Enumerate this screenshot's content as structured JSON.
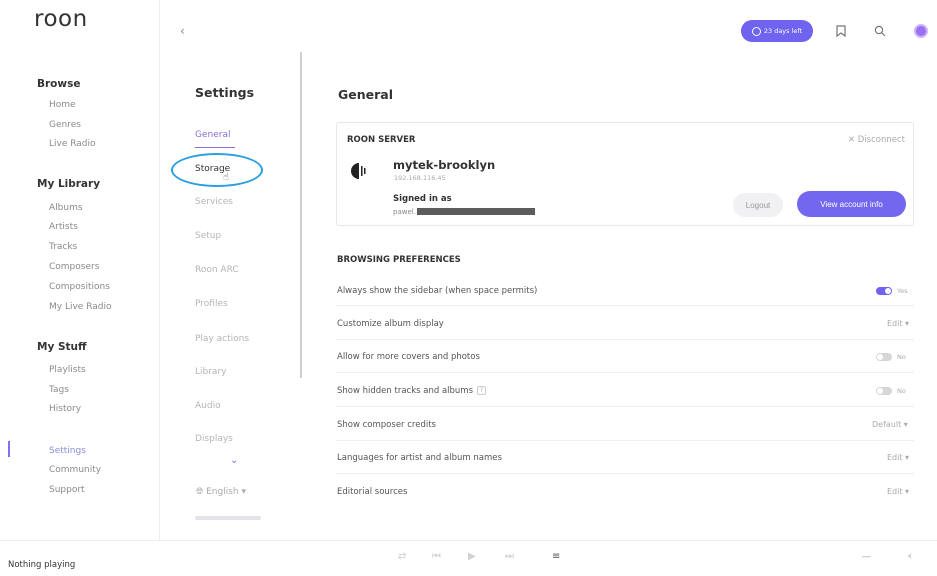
{
  "app": {
    "logo": "roon"
  },
  "sidebar": {
    "sections": [
      {
        "title": "Browse",
        "items": [
          "Home",
          "Genres",
          "Live Radio"
        ]
      },
      {
        "title": "My Library",
        "items": [
          "Albums",
          "Artists",
          "Tracks",
          "Composers",
          "Compositions",
          "My Live Radio"
        ]
      },
      {
        "title": "My Stuff",
        "items": [
          "Playlists",
          "Tags",
          "History"
        ]
      }
    ],
    "bottom_items": [
      "Settings",
      "Community",
      "Support"
    ]
  },
  "topbar": {
    "back_icon": "chevron-left-icon",
    "trial_label": "23 days left",
    "icons": [
      "bookmark-icon",
      "search-icon",
      "avatar"
    ]
  },
  "settings_nav": {
    "title": "Settings",
    "items": [
      "General",
      "Storage",
      "Services",
      "Setup",
      "Roon ARC",
      "Profiles",
      "Play actions",
      "Library",
      "Audio",
      "Displays"
    ],
    "selected": "General",
    "language": "English"
  },
  "main": {
    "title": "General",
    "server": {
      "heading": "ROON SERVER",
      "disconnect": "Disconnect",
      "name": "mytek-brooklyn",
      "ip": "192.168.116.45",
      "signed_in_label": "Signed in as",
      "email_prefix": "pawel.",
      "logout": "Logout",
      "account": "View account info"
    },
    "browsing": {
      "heading": "BROWSING PREFERENCES",
      "prefs": [
        {
          "label": "Always show the sidebar (when space permits)",
          "control": "Yes"
        },
        {
          "label": "Customize album display",
          "control": "Edit"
        },
        {
          "label": "Allow for more covers and photos",
          "control": "No"
        },
        {
          "label": "Show hidden tracks and albums",
          "control": "No"
        },
        {
          "label": "Show composer credits",
          "control": "Default"
        },
        {
          "label": "Languages for artist and album names",
          "control": "Edit"
        },
        {
          "label": "Editorial sources",
          "control": "Edit"
        }
      ]
    }
  },
  "footer": {
    "status": "Nothing playing"
  },
  "colors": {
    "accent": "#6f63ef",
    "highlight_ring": "#2c9fe0"
  }
}
